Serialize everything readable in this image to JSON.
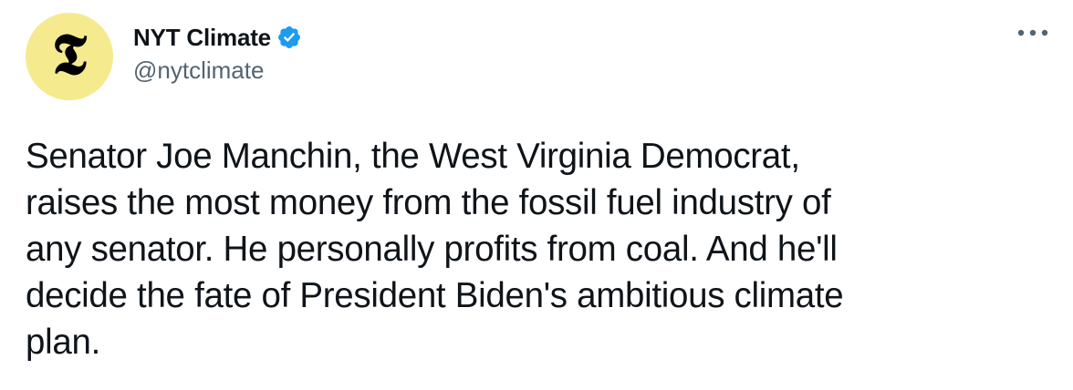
{
  "author": {
    "display_name": "NYT Climate",
    "handle": "@nytclimate",
    "avatar_glyph": "𝕿",
    "avatar_icon": "nyt-logo-icon",
    "avatar_bg": "#f5ea8e",
    "verified_icon": "verified-badge-icon",
    "verified_color": "#1d9bf0"
  },
  "menu": {
    "icon": "more-options-icon"
  },
  "tweet": {
    "text": "Senator Joe Manchin, the West Virginia Democrat,\nraises the most money from the fossil fuel industry of\nany senator. He personally profits from coal. And he'll\ndecide the fate of President Biden's ambitious climate\nplan."
  }
}
